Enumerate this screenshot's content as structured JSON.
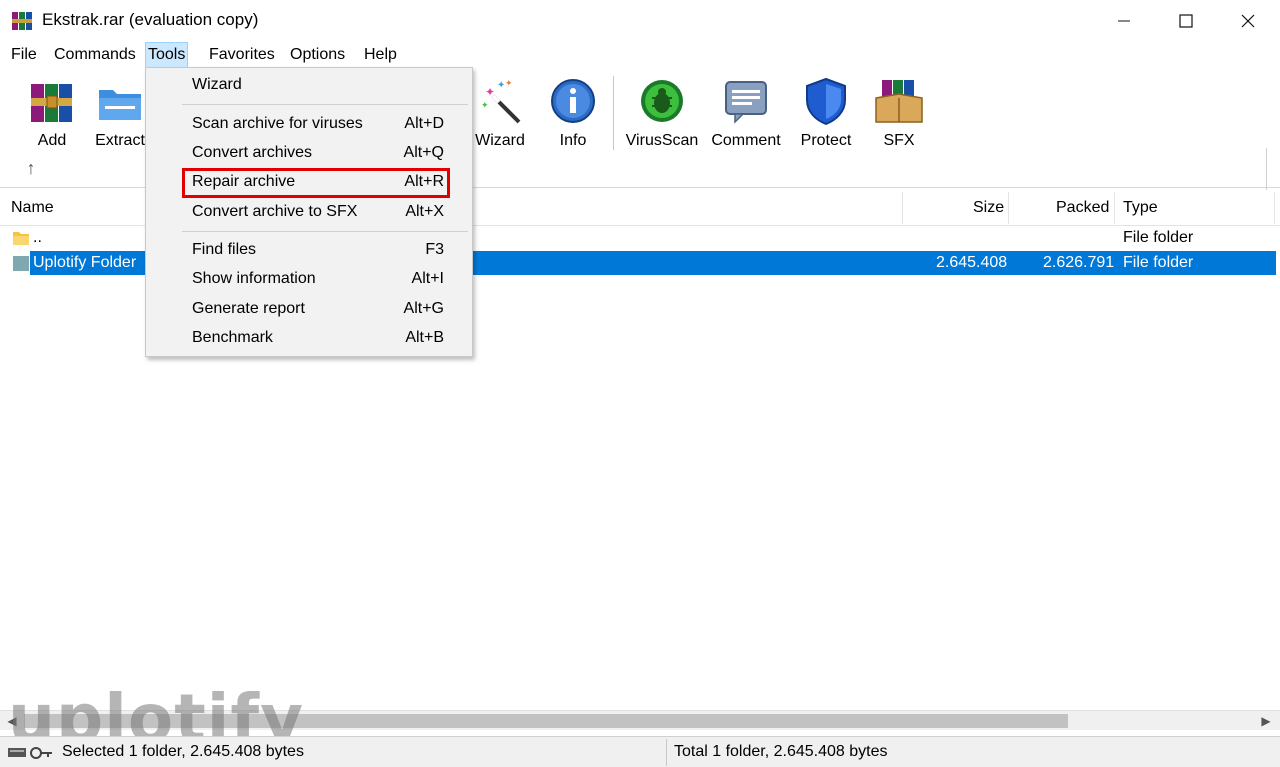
{
  "window": {
    "title": "Ekstrak.rar (evaluation copy)"
  },
  "menubar": {
    "items": [
      {
        "label": "File"
      },
      {
        "label": "Commands"
      },
      {
        "label": "Tools"
      },
      {
        "label": "Favorites"
      },
      {
        "label": "Options"
      },
      {
        "label": "Help"
      }
    ],
    "active": "Tools"
  },
  "toolbar": {
    "buttons": [
      {
        "label": "Add",
        "icon": "add-archive-icon"
      },
      {
        "label": "Extract",
        "icon": "extract-folder-icon"
      },
      {
        "label": "Wizard",
        "icon": "wizard-wand-icon"
      },
      {
        "label": "Info",
        "icon": "info-icon"
      },
      {
        "label": "VirusScan",
        "icon": "virus-scan-icon"
      },
      {
        "label": "Comment",
        "icon": "comment-icon"
      },
      {
        "label": "Protect",
        "icon": "shield-icon"
      },
      {
        "label": "SFX",
        "icon": "sfx-box-icon"
      }
    ],
    "up_icon": "up-arrow-icon"
  },
  "tools_menu": {
    "items": [
      {
        "label": "Wizard",
        "shortcut": ""
      },
      {
        "label": "Scan archive for viruses",
        "shortcut": "Alt+D"
      },
      {
        "label": "Convert archives",
        "shortcut": "Alt+Q"
      },
      {
        "label": "Repair archive",
        "shortcut": "Alt+R",
        "highlighted": true
      },
      {
        "label": "Convert archive to SFX",
        "shortcut": "Alt+X"
      },
      {
        "label": "Find files",
        "shortcut": "F3"
      },
      {
        "label": "Show information",
        "shortcut": "Alt+I"
      },
      {
        "label": "Generate report",
        "shortcut": "Alt+G"
      },
      {
        "label": "Benchmark",
        "shortcut": "Alt+B"
      }
    ],
    "highlight_color": "#e00000"
  },
  "filelist": {
    "columns": {
      "name": "Name",
      "size": "Size",
      "packed": "Packed",
      "type": "Type"
    },
    "rows": [
      {
        "name": "..",
        "size": "",
        "packed": "",
        "type": "File folder",
        "selected": false
      },
      {
        "name": "Uplotify Folder",
        "size": "2.645.408",
        "packed": "2.626.791",
        "type": "File folder",
        "selected": true
      }
    ],
    "selection_color": "#0078d7"
  },
  "statusbar": {
    "left": "Selected 1 folder, 2.645.408 bytes",
    "right": "Total 1 folder, 2.645.408 bytes"
  },
  "watermark": {
    "text": "uplotify"
  }
}
